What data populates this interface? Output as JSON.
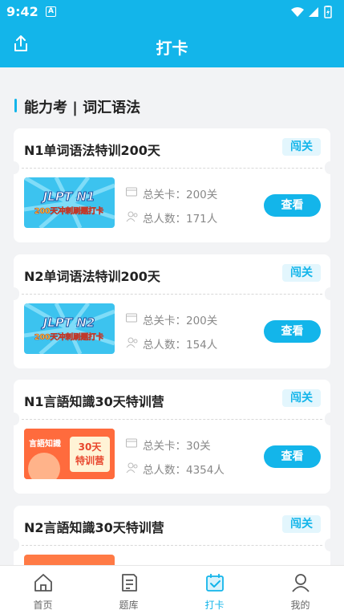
{
  "statusbar": {
    "time": "9:42",
    "app_icon_letter": "A"
  },
  "header": {
    "title": "打卡"
  },
  "section": {
    "title": "能力考 | 词汇语法"
  },
  "cards": [
    {
      "name": "N1单词语法特训200天",
      "badge": "闯关",
      "levels": "总关卡：200关",
      "people": "总人数：171人",
      "button": "查看",
      "thumb": {
        "line1": "JLPT N1",
        "line2": "200天冲刺刷题打卡"
      }
    },
    {
      "name": "N2单词语法特训200天",
      "badge": "闯关",
      "levels": "总关卡：200关",
      "people": "总人数：154人",
      "button": "查看",
      "thumb": {
        "line1": "JLPT N2",
        "line2": "200天冲刺刷题打卡"
      }
    },
    {
      "name": "N1言語知識30天特训营",
      "badge": "闯关",
      "levels": "总关卡：30关",
      "people": "总人数：4354人",
      "button": "查看",
      "thumb": {
        "line1": "言語知識",
        "line2": "30天",
        "line3": "特训营"
      }
    },
    {
      "name": "N2言語知識30天特训营",
      "badge": "闯关"
    }
  ],
  "tabs": [
    {
      "label": "首页",
      "icon": "home-icon"
    },
    {
      "label": "题库",
      "icon": "question-bank-icon"
    },
    {
      "label": "打卡",
      "icon": "checkin-icon"
    },
    {
      "label": "我的",
      "icon": "profile-icon"
    }
  ],
  "colors": {
    "accent": "#13b5ea",
    "background": "#f2f3f5"
  }
}
